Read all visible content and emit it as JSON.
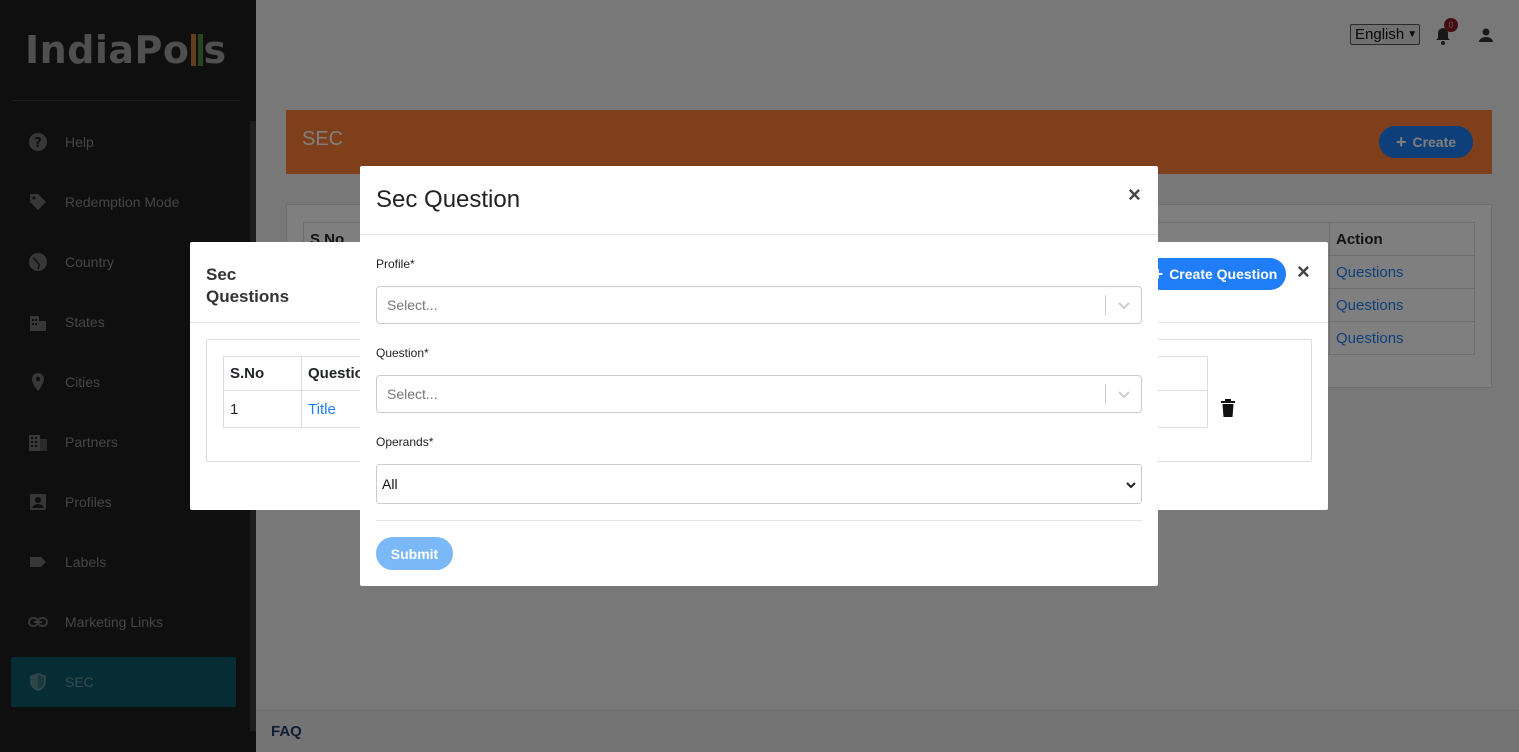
{
  "logo": {
    "text_a": "IndiaPo",
    "text_b": "s"
  },
  "sidebar": {
    "items": [
      {
        "label": "Help",
        "icon": "help-icon"
      },
      {
        "label": "Redemption Mode",
        "icon": "tag-icon"
      },
      {
        "label": "Country",
        "icon": "globe-icon"
      },
      {
        "label": "States",
        "icon": "building-icon"
      },
      {
        "label": "Cities",
        "icon": "location-pin-icon"
      },
      {
        "label": "Partners",
        "icon": "office-icon"
      },
      {
        "label": "Profiles",
        "icon": "profile-icon"
      },
      {
        "label": "Labels",
        "icon": "label-icon"
      },
      {
        "label": "Marketing Links",
        "icon": "link-icon"
      },
      {
        "label": "SEC",
        "icon": "shield-icon",
        "active": true
      }
    ]
  },
  "topbar": {
    "language": "English",
    "notification_count": "0"
  },
  "page": {
    "title": "SEC",
    "create_label": "Create",
    "table": {
      "header_sno": "S.No",
      "header_action": "Action",
      "rows": [
        {
          "action": "Questions"
        },
        {
          "action": "Questions"
        },
        {
          "action": "Questions"
        }
      ]
    }
  },
  "footer": {
    "faq": "FAQ"
  },
  "sec_questions_modal": {
    "title": "Sec Questions",
    "create_question_label": "Create Question",
    "close": "×",
    "table": {
      "header_sno": "S.No",
      "header_question": "Question",
      "rows": [
        {
          "sno": "1",
          "question": "Title"
        }
      ]
    }
  },
  "sec_question_form": {
    "title": "Sec Question",
    "close": "×",
    "profile_label": "Profile*",
    "profile_placeholder": "Select...",
    "question_label": "Question*",
    "question_placeholder": "Select...",
    "operands_label": "Operands*",
    "operands_value": "All",
    "submit_label": "Submit"
  },
  "colors": {
    "accent": "#1f7ef7",
    "header": "#ff7f35",
    "active_nav": "#0a5a66"
  }
}
